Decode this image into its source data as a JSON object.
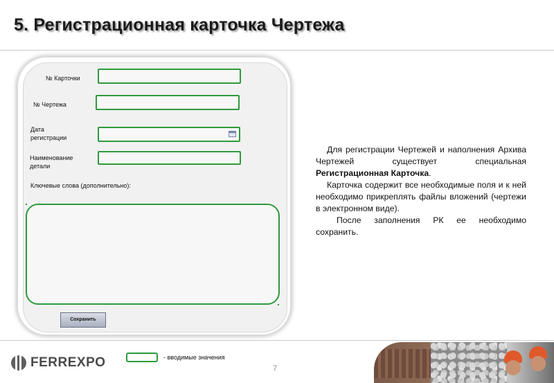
{
  "slide": {
    "title": "5. Регистрационная карточка Чертежа",
    "page_number": "7"
  },
  "form": {
    "card_number_label": "№ Карточки",
    "drawing_number_label": "№ Чертежа",
    "registration_date_label_line1": "Дата",
    "registration_date_label_line2": "регистрации",
    "part_name_label_line1": "Наименование",
    "part_name_label_line2": "детали",
    "keywords_label": "Ключевые слова (дополнительно):",
    "card_number_value": "",
    "drawing_number_value": "",
    "registration_date_value": "",
    "part_name_value": "",
    "keywords_value": "",
    "save_button_label": "Сохранить"
  },
  "description": {
    "p1_before": "Для регистрации Чертежей и наполнения Архива Чертежей существует специальная ",
    "p1_bold": "Регистрационная Карточка",
    "p1_after": ".",
    "p2": "Карточка содержит все необходимые поля и к ней необходимо прикреплять файлы вложений (чертежи в электронном виде).",
    "p3": "После заполнения РК ее необходимо сохранить."
  },
  "legend": {
    "text": "- вводимые значения"
  },
  "footer": {
    "logo_text": "FERREXPO"
  },
  "colors": {
    "field_border": "#2e9a3c",
    "title_text": "#1a1a1a"
  },
  "icons": {
    "date_picker": "calendar-icon",
    "logo": "ferrexpo-logo-mark"
  }
}
